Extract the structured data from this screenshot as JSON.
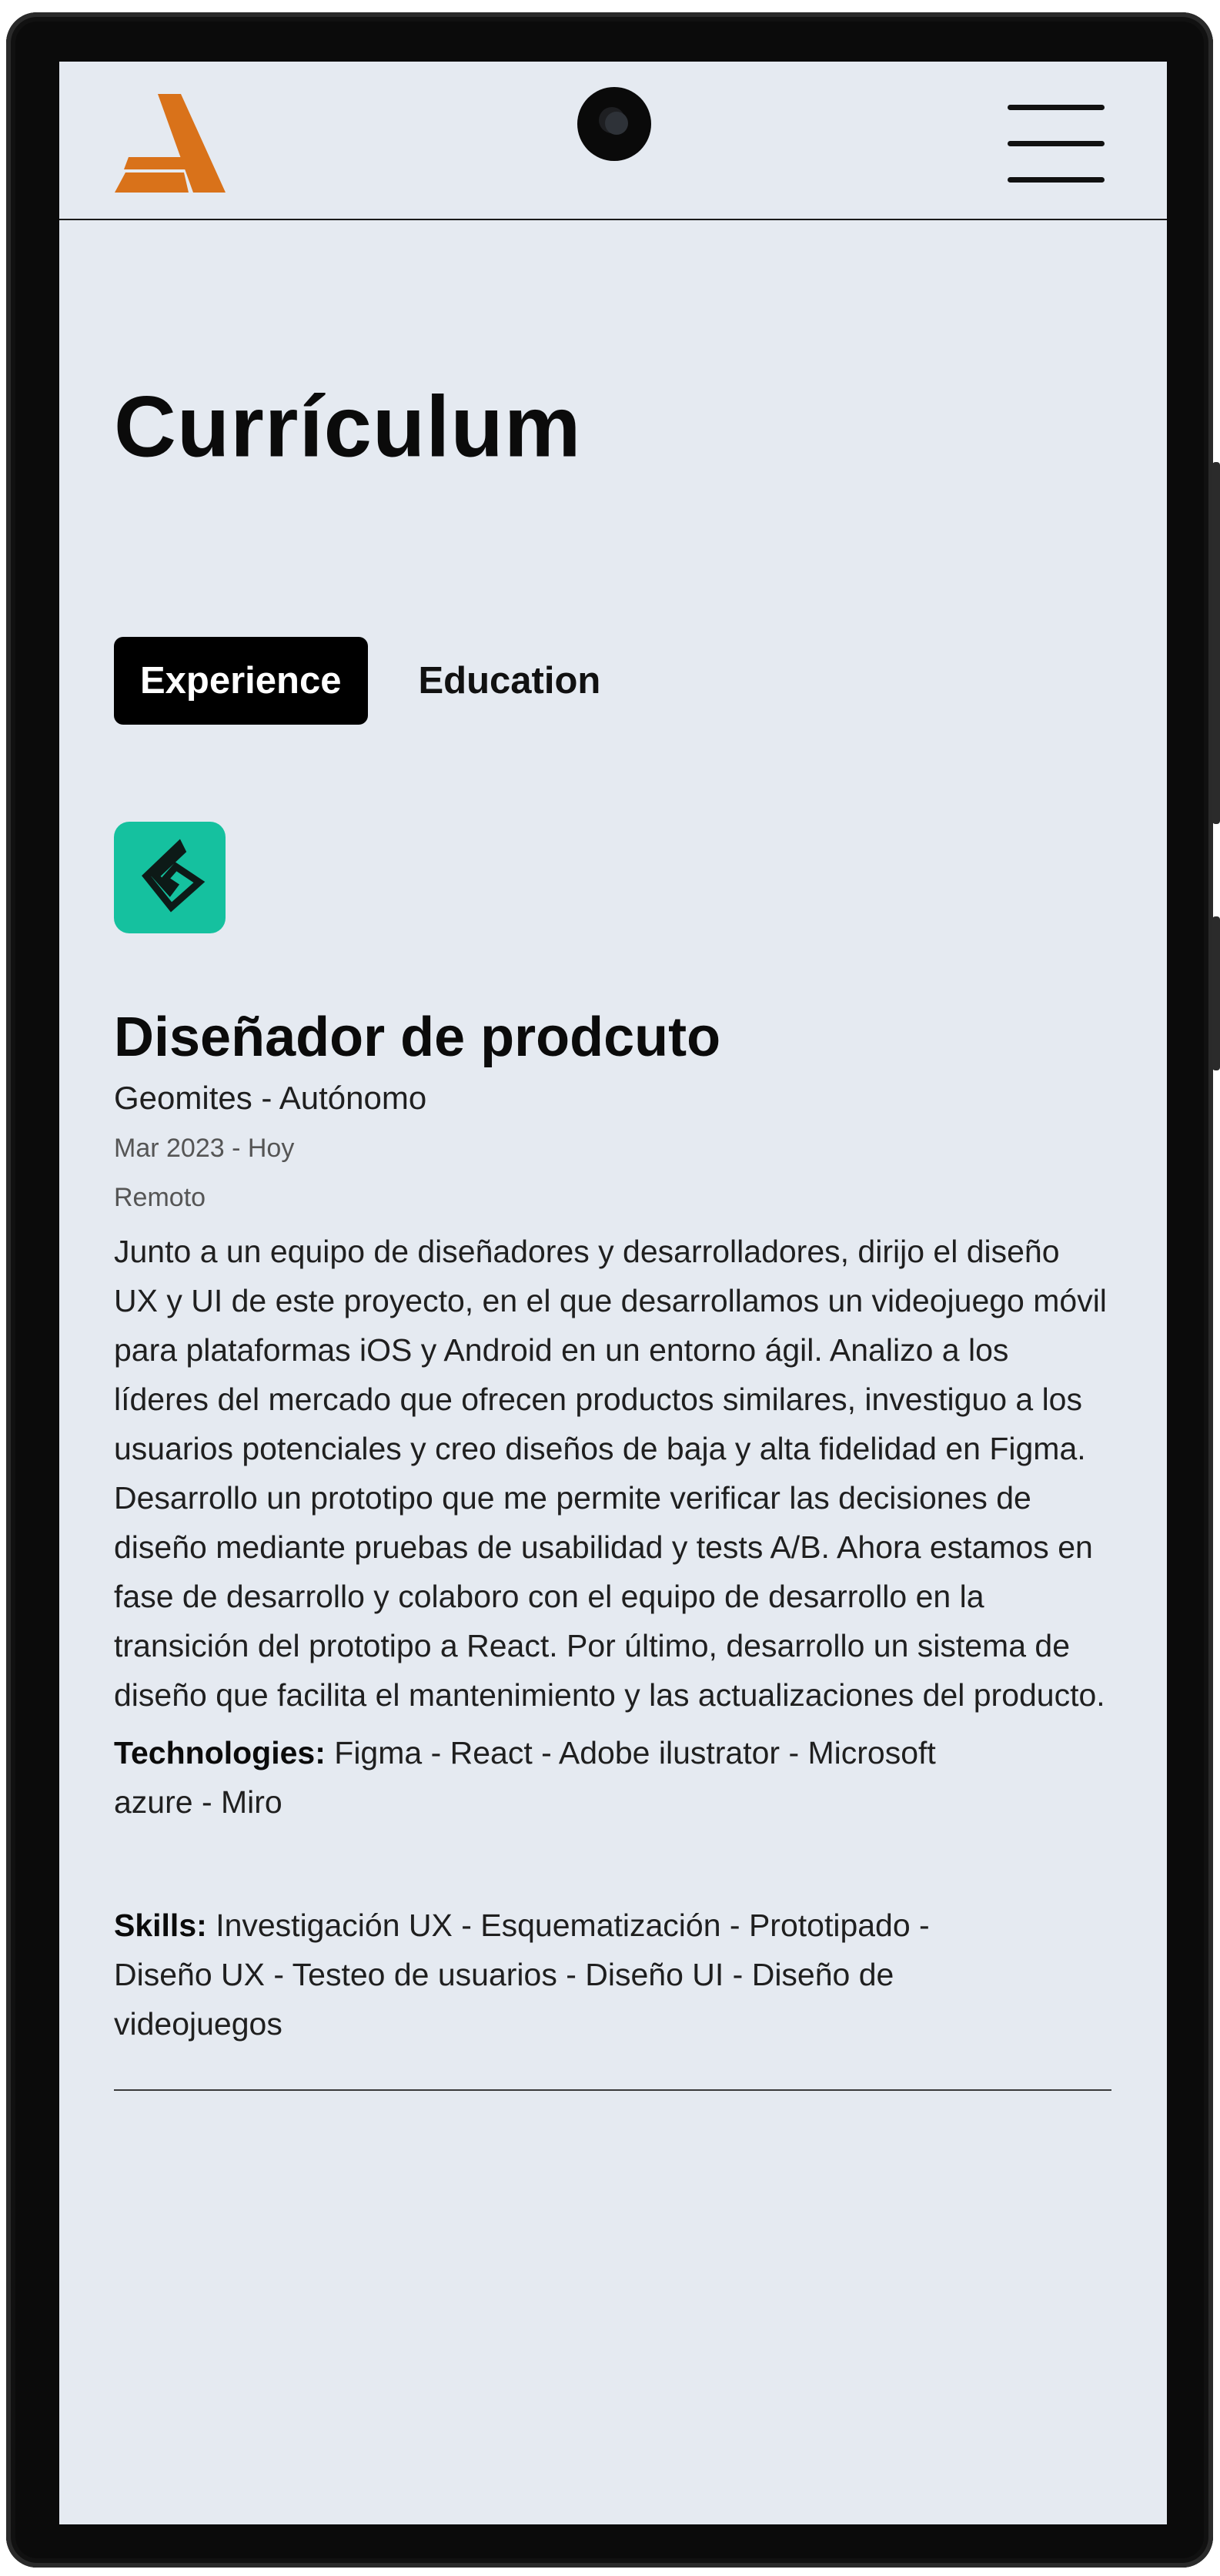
{
  "header": {
    "logo_icon": "brand-a-logo",
    "menu_icon": "hamburger-menu-icon",
    "accent_color": "#D9721A"
  },
  "page": {
    "title": "Currículum"
  },
  "tabs": [
    {
      "label": "Experience",
      "active": true
    },
    {
      "label": "Education",
      "active": false
    }
  ],
  "experience": {
    "company_logo_icon": "geomites-logo",
    "company_logo_color": "#15C19F",
    "role": "Diseñador de prodcuto",
    "company": "Geomites - Autónomo",
    "dates": "Mar 2023 - Hoy",
    "location": "Remoto",
    "description": "Junto a un equipo de diseñadores y desarrolladores, dirijo el diseño UX y UI de este proyecto, en el que desarrollamos un videojuego móvil para plataformas iOS y Android en un entorno ágil. Analizo a los líderes del mercado que ofrecen productos similares, investiguo a los usuarios potenciales y creo diseños de baja y alta fidelidad en Figma. Desarrollo un prototipo que me permite verificar las decisiones de diseño mediante pruebas de usabilidad y tests A/B. Ahora estamos en fase de desarrollo y colaboro con el equipo de desarrollo en la transición del prototipo a React. Por último, desarrollo un sistema de diseño que facilita el mantenimiento y las actualizaciones del producto.",
    "technologies_label": "Technologies:",
    "technologies": "Figma - React - Adobe ilustrator - Microsoft azure - Miro",
    "skills_label": "Skills:",
    "skills": "Investigación UX - Esquematización - Prototipado - Diseño UX - Testeo de usuarios - Diseño UI - Diseño de videojuegos"
  }
}
